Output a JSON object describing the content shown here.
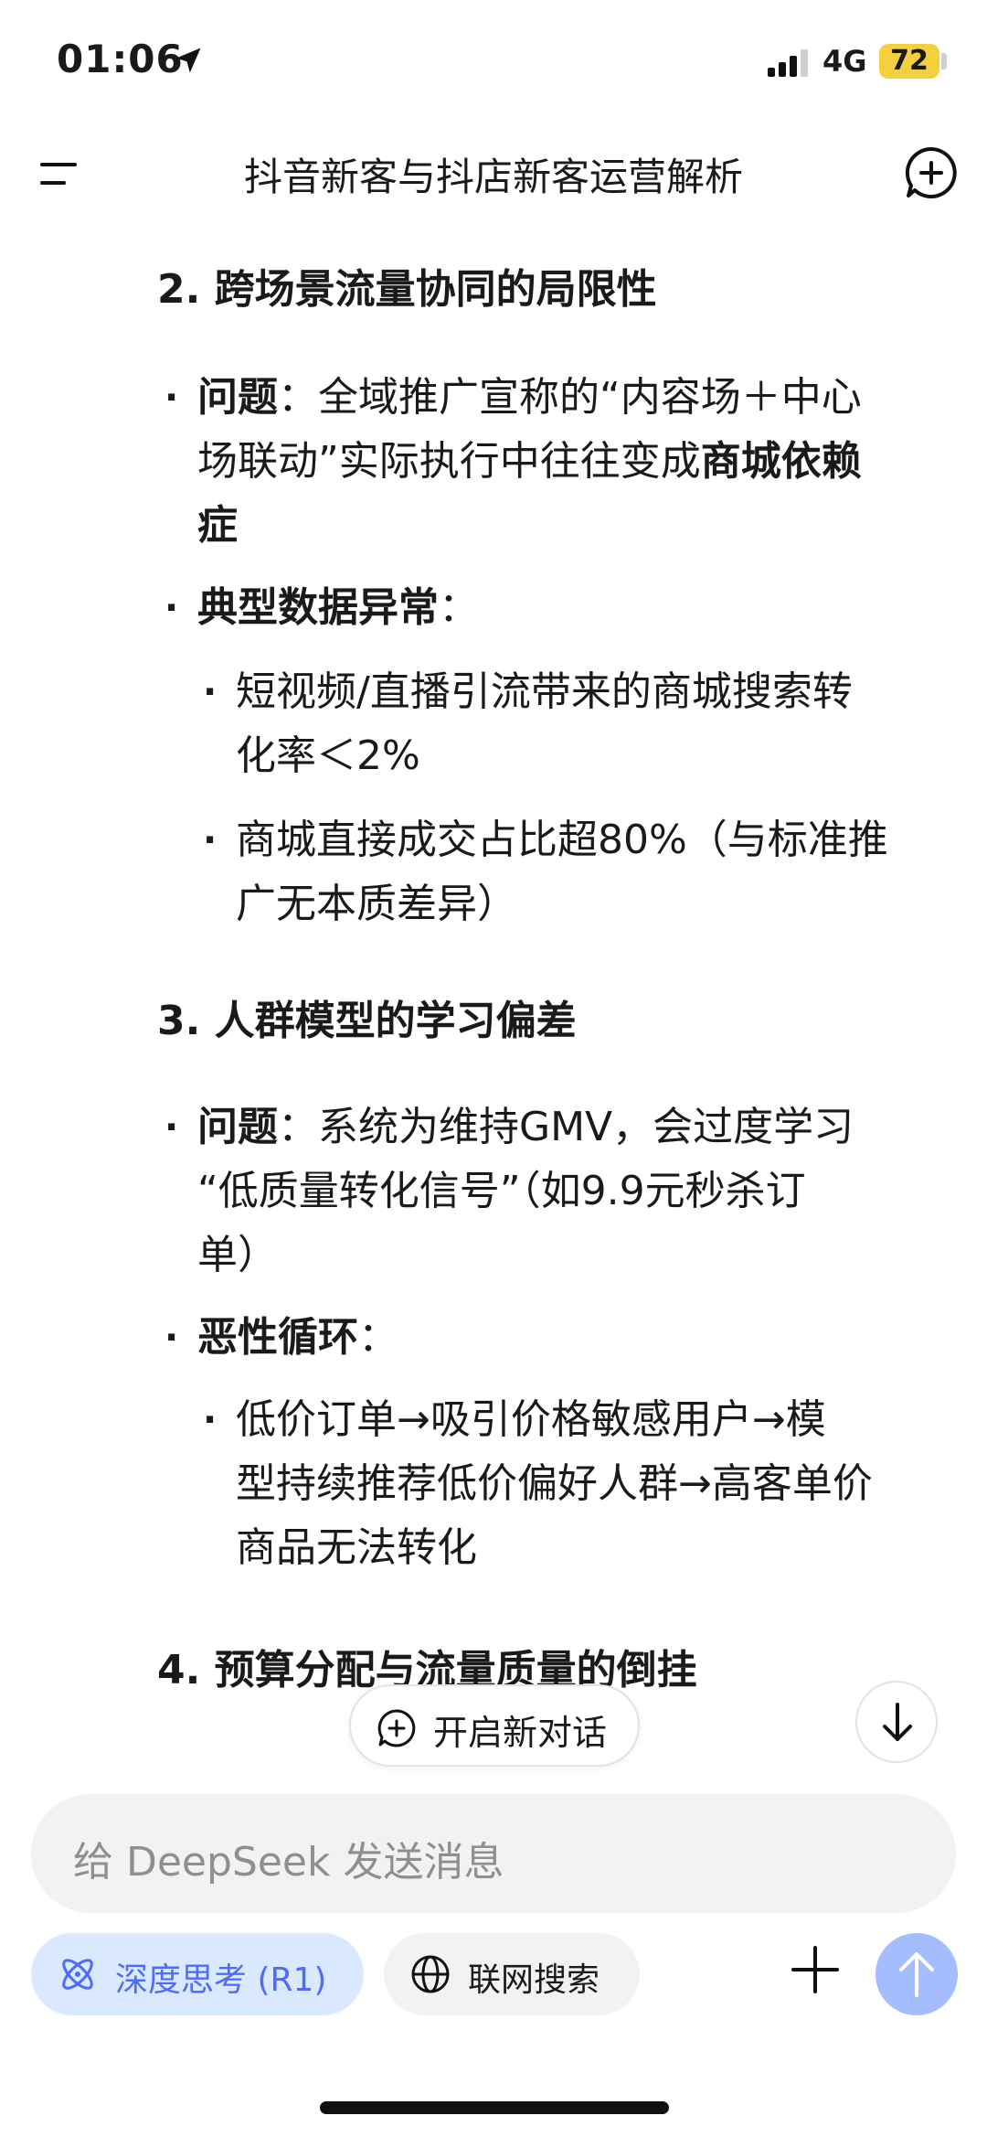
{
  "status_bar": {
    "time": "01:06",
    "network": "4G",
    "battery": "72"
  },
  "header": {
    "title": "抖音新客与抖店新客运营解析"
  },
  "content": {
    "sections": [
      {
        "heading": "2. 跨场景流量协同的局限性",
        "bullets": [
          {
            "label": "问题",
            "sep": "：",
            "line1": "全域推广宣称的“内容场＋中心",
            "line2_pre": "场联动”实际执行中往往变成",
            "line2_bold": "商城依赖",
            "line3_bold": "症"
          },
          {
            "label": "典型数据异常",
            "sep": "：",
            "sub": [
              {
                "line1": "短视频/直播引流带来的商城搜索转",
                "line2": "化率＜2%"
              },
              {
                "line1": "商城直接成交占比超80%（与标准推",
                "line2": "广无本质差异）"
              }
            ]
          }
        ]
      },
      {
        "heading": "3. 人群模型的学习偏差",
        "bullets": [
          {
            "label": "问题",
            "sep": "：",
            "line1": "系统为维持GMV，会过度学习",
            "line2": "“低质量转化信号”（如9.9元秒杀订",
            "line3": "单）"
          },
          {
            "label": "恶性循环",
            "sep": "：",
            "sub": [
              {
                "line1": "低价订单→吸引价格敏感用户→模",
                "line2": "型持续推荐低价偏好人群→高客单价",
                "line3": "商品无法转化"
              }
            ]
          }
        ]
      },
      {
        "heading": "4. 预算分配与流量质量的倒挂"
      }
    ]
  },
  "floating": {
    "new_chat": "开启新对话"
  },
  "composer": {
    "placeholder": "给 DeepSeek 发送消息",
    "deep_think": "深度思考 (R1)",
    "web_search": "联网搜索"
  },
  "colors": {
    "accent": "#4d6bfe",
    "deep_chip_bg": "#dbe9ff",
    "send_bg": "#a4bdfd",
    "battery": "#f4d03f"
  }
}
